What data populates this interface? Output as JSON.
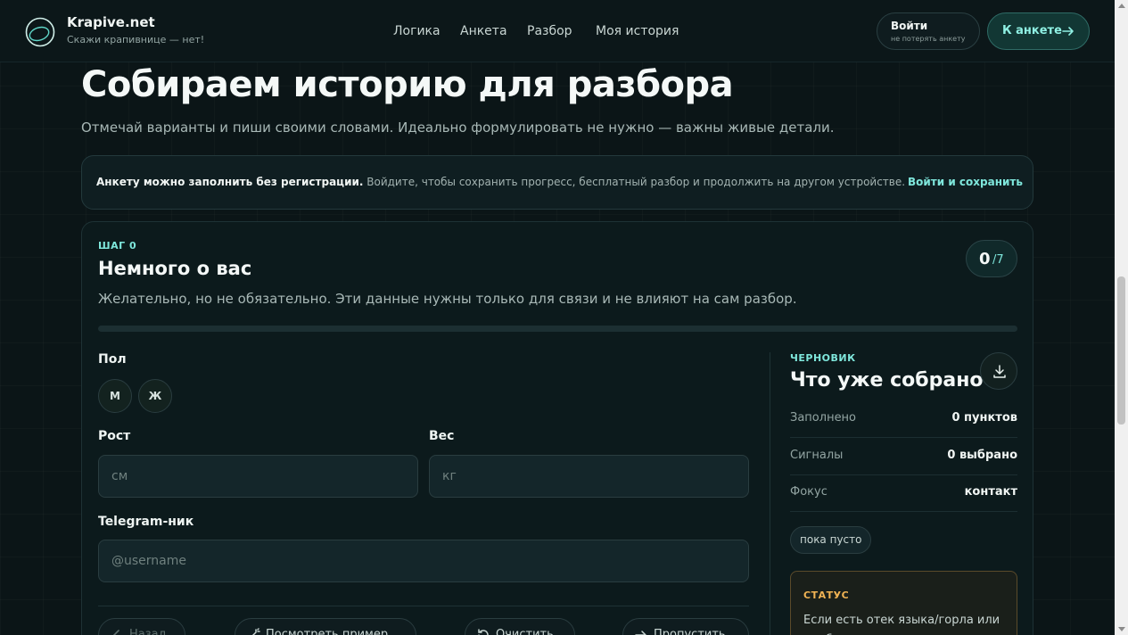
{
  "header": {
    "brand_title": "Krapive.net",
    "brand_subtitle": "Скажи крапивнице — нет!",
    "nav": [
      {
        "label": "Логика"
      },
      {
        "label": "Анкета"
      },
      {
        "label": "Разбор"
      },
      {
        "label": "Моя история"
      }
    ],
    "login_label": "Войти",
    "login_sub": "не потерять анкету",
    "anketa_label": "К анкете"
  },
  "page": {
    "title": "Собираем историю для разбора",
    "subtitle": "Отмечай варианты и пиши своими словами. Идеально формулировать не нужно — важны живые детали."
  },
  "notice": {
    "bold": "Анкету можно заполнить без регистрации.",
    "text": " Войдите, чтобы сохранить прогресс, бесплатный разбор и продолжить на другом устройстве.",
    "link": "Войти и сохранить"
  },
  "step": {
    "label": "ШАГ 0",
    "title": "Немного о вас",
    "description": "Желательно, но не обязательно. Эти данные нужны только для связи и не влияют на сам разбор.",
    "count": "0",
    "total": "/7",
    "progress": 0
  },
  "form": {
    "gender_label": "Пол",
    "gender_options": [
      "М",
      "Ж"
    ],
    "height_label": "Рост",
    "height_placeholder": "см",
    "weight_label": "Вес",
    "weight_placeholder": "кг",
    "telegram_label": "Telegram-ник",
    "telegram_placeholder": "@username",
    "buttons": {
      "back": "Назад",
      "example": "Посмотреть пример",
      "clear": "Очистить",
      "skip": "Пропустить"
    }
  },
  "draft": {
    "label": "ЧЕРНОВИК",
    "title": "Что уже собрано",
    "stats": [
      {
        "key": "Заполнено",
        "value": "0 пунктов"
      },
      {
        "key": "Сигналы",
        "value": "0 выбрано"
      },
      {
        "key": "Фокус",
        "value": "контакт"
      }
    ],
    "empty_chip": "пока пусто",
    "status_heading": "СТАТУС",
    "status_text": "Если есть отек языка/горла или проблемы с дыханием"
  },
  "colors": {
    "accent": "#7fe7dc",
    "status": "#f0b354",
    "background": "#0b1517"
  }
}
